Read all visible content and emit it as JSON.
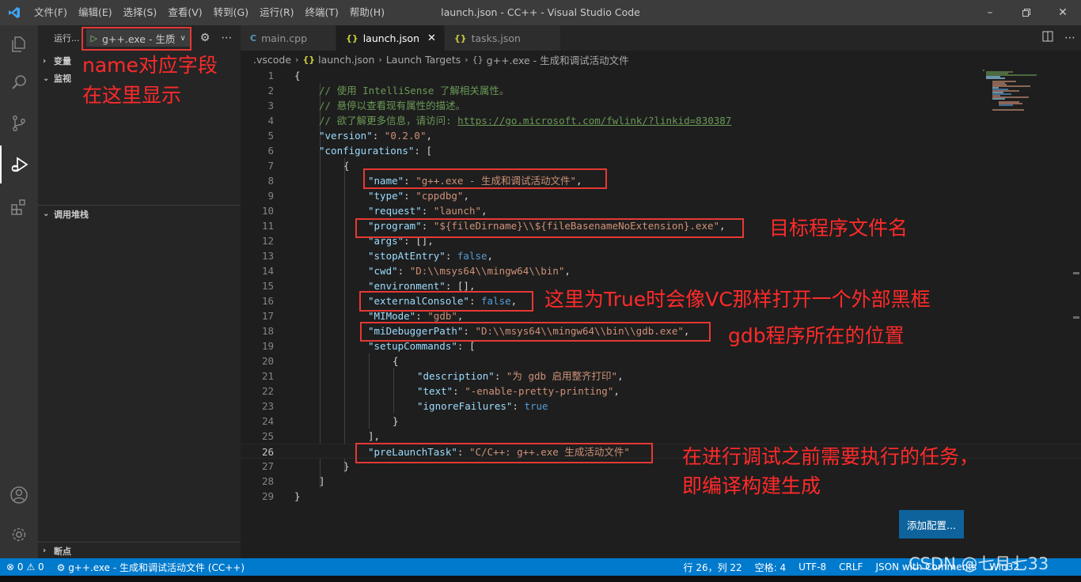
{
  "window": {
    "title": "launch.json - CC++ - Visual Studio Code",
    "menu": [
      "文件(F)",
      "编辑(E)",
      "选择(S)",
      "查看(V)",
      "转到(G)",
      "运行(R)",
      "终端(T)",
      "帮助(H)"
    ]
  },
  "sidebar": {
    "run_label": "运行...",
    "run_config": "g++.exe - 生质",
    "sections": {
      "variables": "变量",
      "watch": "监视",
      "callstack": "调用堆栈",
      "breakpoints": "断点"
    }
  },
  "tabs": [
    {
      "label": "main.cpp",
      "icon": "cpp-file-icon"
    },
    {
      "label": "launch.json",
      "icon": "json-file-icon",
      "active": true
    },
    {
      "label": "tasks.json",
      "icon": "json-file-icon"
    }
  ],
  "breadcrumb": {
    "folder": ".vscode",
    "file": "launch.json",
    "node1": "Launch Targets",
    "node2": "g++.exe - 生成和调试活动文件"
  },
  "code": {
    "l1": "{",
    "l2": "// 使用 IntelliSense 了解相关属性。",
    "l3": "// 悬停以查看现有属性的描述。",
    "l4_comment": "// 欲了解更多信息，请访问: ",
    "l4_url": "https://go.microsoft.com/fwlink/?linkid=830387",
    "l5_key": "\"version\"",
    "l5_val": "\"0.2.0\"",
    "l6_key": "\"configurations\"",
    "l6_rest": ": [",
    "l7": "{",
    "l8_key": "\"name\"",
    "l8_val": "\"g++.exe - 生成和调试活动文件\"",
    "l9_key": "\"type\"",
    "l9_val": "\"cppdbg\"",
    "l10_key": "\"request\"",
    "l10_val": "\"launch\"",
    "l11_key": "\"program\"",
    "l11_val": "\"${fileDirname}\\\\${fileBasenameNoExtension}.exe\"",
    "l12_key": "\"args\"",
    "l12_rest": ": [],",
    "l13_key": "\"stopAtEntry\"",
    "l13_val": "false",
    "l14_key": "\"cwd\"",
    "l14_val": "\"D:\\\\msys64\\\\mingw64\\\\bin\"",
    "l15_key": "\"environment\"",
    "l15_rest": ": [],",
    "l16_key": "\"externalConsole\"",
    "l16_val": "false",
    "l17_key": "\"MIMode\"",
    "l17_val": "\"gdb\"",
    "l18_key": "\"miDebuggerPath\"",
    "l18_val": "\"D:\\\\msys64\\\\mingw64\\\\bin\\\\gdb.exe\"",
    "l19_key": "\"setupCommands\"",
    "l19_rest": ": [",
    "l20": "{",
    "l21_key": "\"description\"",
    "l21_val": "\"为 gdb 启用整齐打印\"",
    "l22_key": "\"text\"",
    "l22_val": "\"-enable-pretty-printing\"",
    "l23_key": "\"ignoreFailures\"",
    "l23_val": "true",
    "l24": "}",
    "l25": "],",
    "l26_key": "\"preLaunchTask\"",
    "l26_val": "\"C/C++: g++.exe 生成活动文件\"",
    "l27": "}",
    "l28": "]",
    "l29": "}"
  },
  "add_config_button": "添加配置...",
  "statusbar": {
    "errors": "0",
    "warnings": "0",
    "debug_config": "g++.exe - 生成和调试活动文件 (CC++)",
    "position": "行 26，列 22",
    "spaces": "空格: 4",
    "encoding": "UTF-8",
    "eol": "CRLF",
    "language": "JSON with Comments",
    "platform": "Win32"
  },
  "annotations": {
    "name_note_1": "name对应字段",
    "name_note_2": "在这里显示",
    "program_note": "目标程序文件名",
    "console_note": "这里为True时会像VC那样打开一个外部黑框",
    "debugger_note": "gdb程序所在的位置",
    "prelaunch_note_1": "在进行调试之前需要执行的任务，",
    "prelaunch_note_2": "即编译构建生成"
  },
  "watermark": "CSDN @七月七33",
  "colors": {
    "accent": "#007acc",
    "annotation": "#e53935",
    "json_key": "#9cdcfe",
    "json_string": "#ce9178",
    "comment": "#6a9955",
    "keyword": "#569cd6"
  }
}
